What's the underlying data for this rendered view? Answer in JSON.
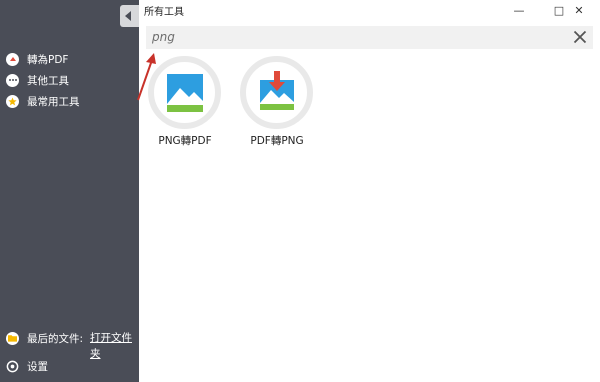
{
  "window": {
    "title": "所有工具",
    "minimize_glyph": "—",
    "maximize_glyph": "□",
    "close_glyph": "✕"
  },
  "sidebar": {
    "collapse_icon": "chevron-left-icon",
    "items": [
      {
        "label": "轉為PDF",
        "icon": "convert-pdf-icon"
      },
      {
        "label": "其他工具",
        "icon": "more-dots-icon"
      },
      {
        "label": "最常用工具",
        "icon": "star-icon"
      }
    ],
    "recent_files": {
      "label": "最后的文件:",
      "link": "打开文件夹",
      "icon": "folder-icon"
    },
    "settings": {
      "label": "设置",
      "icon": "gear-icon"
    }
  },
  "search": {
    "value": "png",
    "clear_icon": "close-icon"
  },
  "tools": [
    {
      "label": "PNG轉PDF",
      "icon": "image-icon"
    },
    {
      "label": "PDF轉PNG",
      "icon": "pdf-to-image-icon"
    }
  ],
  "colors": {
    "sidebar_bg": "#4a4d57",
    "image_blue": "#2d9ee0",
    "image_green": "#7cc242",
    "accent_red": "#e04a3a",
    "star_yellow": "#f5b800",
    "folder_yellow": "#f5b800"
  }
}
